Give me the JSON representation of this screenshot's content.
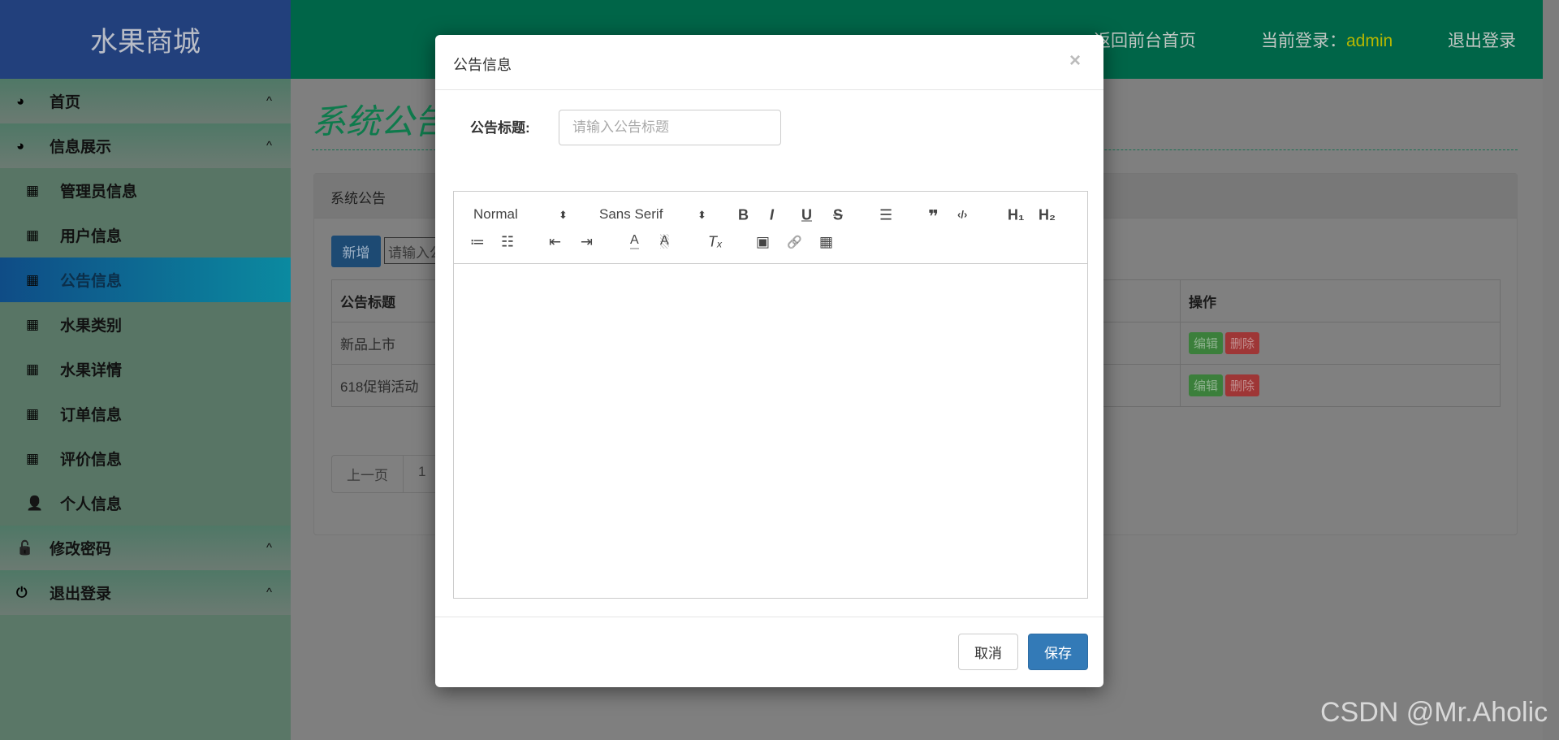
{
  "app": {
    "title": "水果商城"
  },
  "header": {
    "back_link": "返回前台首页",
    "login_label": "当前登录：",
    "username": "admin",
    "logout": "退出登录",
    "username_color": "#c8c800"
  },
  "sidebar": {
    "items": [
      {
        "label": "首页",
        "icon": "dashboard-icon",
        "type": "group"
      },
      {
        "label": "信息展示",
        "icon": "dashboard-icon",
        "type": "group"
      },
      {
        "label": "管理员信息",
        "icon": "table-icon",
        "type": "sub"
      },
      {
        "label": "用户信息",
        "icon": "table-icon",
        "type": "sub"
      },
      {
        "label": "公告信息",
        "icon": "table-icon",
        "type": "sub",
        "active": true
      },
      {
        "label": "水果类别",
        "icon": "table-icon",
        "type": "sub"
      },
      {
        "label": "水果详情",
        "icon": "table-icon",
        "type": "sub"
      },
      {
        "label": "订单信息",
        "icon": "table-icon",
        "type": "sub"
      },
      {
        "label": "评价信息",
        "icon": "table-icon",
        "type": "sub"
      },
      {
        "label": "个人信息",
        "icon": "user-icon",
        "type": "sub"
      },
      {
        "label": "修改密码",
        "icon": "lock-icon",
        "type": "group"
      },
      {
        "label": "退出登录",
        "icon": "power-icon",
        "type": "group"
      }
    ],
    "chevron": "^"
  },
  "main": {
    "page_title": "系统公告",
    "panel_title": "系统公告",
    "add_button": "新增",
    "search_placeholder": "请输入公告标题",
    "table": {
      "headers": [
        "公告标题",
        "操作"
      ],
      "rows": [
        {
          "title": "新品上市"
        },
        {
          "title": "618促销活动"
        }
      ],
      "edit": "编辑",
      "delete": "删除"
    },
    "pager": {
      "prev": "上一页",
      "page": "1"
    }
  },
  "modal": {
    "title": "公告信息",
    "close": "×",
    "field_label": "公告标题:",
    "field_placeholder": "请输入公告标题",
    "field_value": "",
    "toolbar": {
      "header_select": "Normal",
      "font_select": "Sans Serif",
      "sel_arrow": "⬍",
      "bold": "B",
      "italic": "I",
      "underline": "U",
      "strike": "S",
      "align": "☰",
      "quote": "❞",
      "code": "‹/›",
      "h1": "H₁",
      "h2": "H₂",
      "ol": "≔",
      "ul": "☷",
      "outdent": "⇤",
      "indent": "⇥",
      "color": "A",
      "background": "A",
      "clean": "Tₓ",
      "image": "▣",
      "link": "🔗",
      "video": "▦"
    },
    "cancel": "取消",
    "save": "保存"
  },
  "watermark": "CSDN @Mr.Aholic"
}
